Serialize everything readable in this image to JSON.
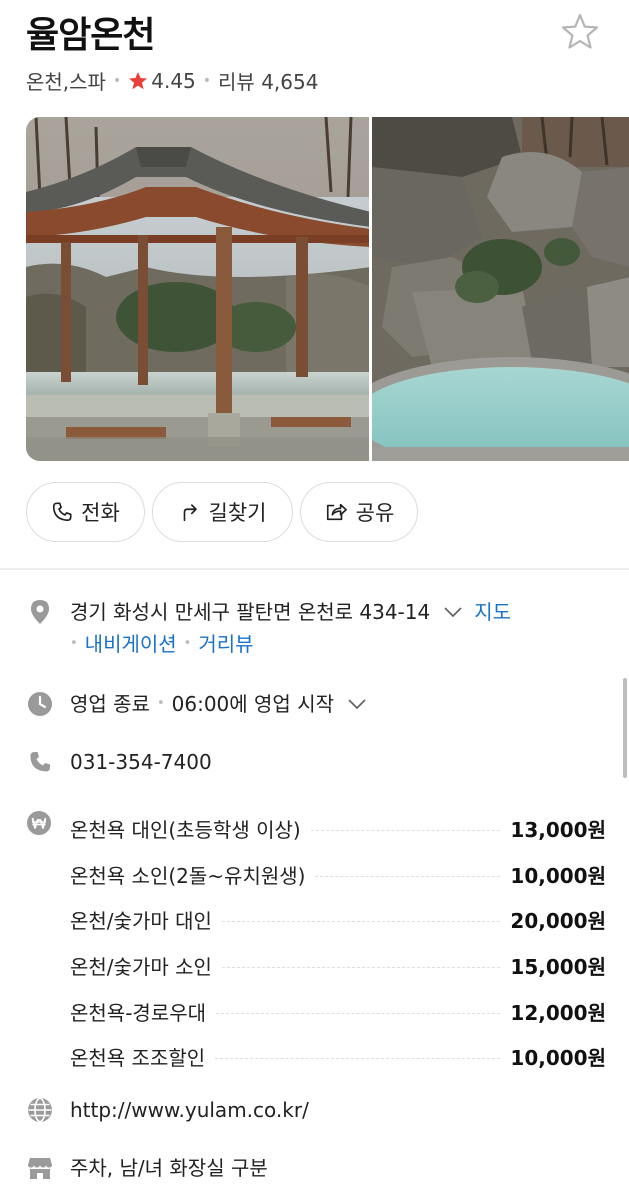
{
  "place": {
    "name": "율암온천",
    "category": "온천,스파",
    "rating": "4.45",
    "review_label": "리뷰 4,654",
    "rating_color": "#e8403c"
  },
  "actions": {
    "call": "전화",
    "route": "길찾기",
    "share": "공유"
  },
  "info": {
    "address": "경기 화성시 만세구 팔탄면 온천로 434-14",
    "map_link": "지도",
    "navigation_link": "내비게이션",
    "streetview_link": "거리뷰",
    "status": "영업 종료",
    "next_open": "06:00에 영업 시작",
    "phone": "031-354-7400",
    "website": "http://www.yulam.co.kr/",
    "facilities": "주차, 남/녀 화장실 구분",
    "link_color": "#1a73c8"
  },
  "prices": [
    {
      "name": "온천욕 대인(초등학생 이상)",
      "price": "13,000원"
    },
    {
      "name": "온천욕 소인(2돌~유치원생)",
      "price": "10,000원"
    },
    {
      "name": "온천/숯가마 대인",
      "price": "20,000원"
    },
    {
      "name": "온천/숯가마 소인",
      "price": "15,000원"
    },
    {
      "name": "온천욕-경로우대",
      "price": "12,000원"
    },
    {
      "name": "온천욕 조조할인",
      "price": "10,000원"
    }
  ],
  "icons": [
    "star-outline-icon",
    "rating-star-icon",
    "phone-icon",
    "route-icon",
    "share-icon",
    "location-pin-icon",
    "clock-icon",
    "phone-icon",
    "won-icon",
    "globe-icon",
    "store-icon",
    "chevron-down-icon"
  ]
}
